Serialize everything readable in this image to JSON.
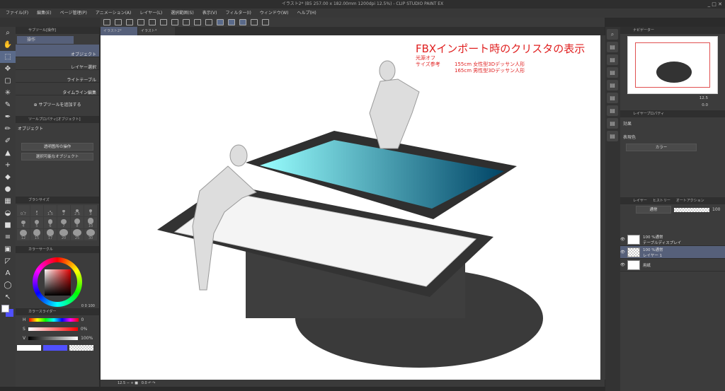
{
  "window": {
    "title": "イラスト2* (B5 257.00 x 182.00mm 1200dpi 12.5%) - CLIP STUDIO PAINT EX",
    "controls": "_ □ ✕"
  },
  "menu": [
    "ファイル(F)",
    "編集(E)",
    "ページ管理(P)",
    "アニメーション(A)",
    "レイヤー(L)",
    "選択範囲(S)",
    "表示(V)",
    "フィルター(I)",
    "ウィンドウ(W)",
    "ヘルプ(H)"
  ],
  "tabs": [
    {
      "label": "イラスト2*"
    },
    {
      "label": "イラスト*"
    }
  ],
  "subtool": {
    "header": "サブツール[操作]",
    "group": "操作",
    "items": [
      "オブジェクト",
      "レイヤー選択",
      "ライトテーブル",
      "タイムライン編集"
    ],
    "add": "サブツールを追加する"
  },
  "toolprop": {
    "header": "ツールプロパティ[オブジェクト]",
    "title": "オブジェクト",
    "selects": [
      "透明箇所の操作",
      "選択可能なオブジェクト"
    ]
  },
  "brushsize": {
    "header": "ブラシサイズ",
    "sizes": [
      "0.7",
      "1",
      "1.5",
      "2",
      "2.5",
      "3",
      "4",
      "5",
      "6",
      "7",
      "8",
      "10",
      "12",
      "15",
      "17",
      "20",
      "25",
      "30"
    ]
  },
  "colorcircle": {
    "header": "カラーサークル",
    "readout": "0  0  100"
  },
  "colorslider": {
    "header": "カラースライダー",
    "rows": [
      {
        "label": "H",
        "value": "0"
      },
      {
        "label": "S",
        "value": "0%"
      },
      {
        "label": "V",
        "value": "100%"
      }
    ]
  },
  "canvas_text": {
    "title": "FBXインポート時のクリスタの表示",
    "line1": "光源オフ",
    "line2_label": "サイズ参考",
    "line2a": "155cm 女性型3Dデッサン人形",
    "line2b": "165cm 男性型3Dデッサン人形"
  },
  "statusbar": {
    "zoom": "12.5",
    "angle": "0.0"
  },
  "navigator": {
    "header": "ナビゲーター",
    "zoom": "12.5",
    "angle": "0.0"
  },
  "layerprop": {
    "header": "レイヤープロパティ",
    "effect": "効果",
    "color_label": "表現色",
    "color_value": "カラー"
  },
  "layers": {
    "tabs": [
      "レイヤー",
      "ヒストリー",
      "オートアクション"
    ],
    "blend": "通常",
    "opacity": "100",
    "items": [
      {
        "mode": "100 %通常",
        "name": "テーブルディスプレイ"
      },
      {
        "mode": "100 %通常",
        "name": "レイヤー 1"
      },
      {
        "mode": "",
        "name": "用紙"
      }
    ]
  },
  "colors": {
    "accent": "#56607a",
    "main": "#ffffff",
    "sub": "#5050ff",
    "canvas_text": "#e02020"
  }
}
